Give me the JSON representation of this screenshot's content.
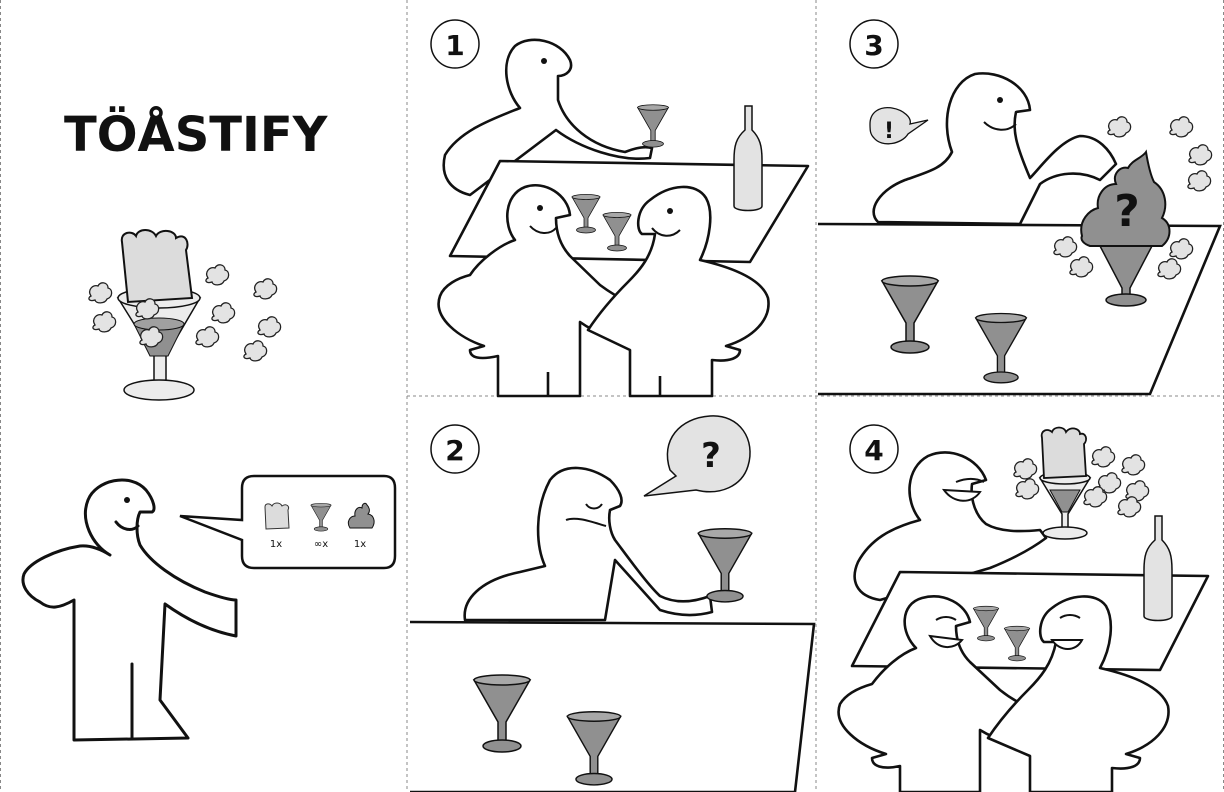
{
  "title": "TÖÅSTIFY",
  "parts": [
    {
      "icon": "bread-slice-icon",
      "qty": "1x"
    },
    {
      "icon": "cocktail-glass-icon",
      "qty": "∞x"
    },
    {
      "icon": "mystery-blob-icon",
      "qty": "1x"
    }
  ],
  "steps": [
    {
      "number": "1",
      "glyph": ""
    },
    {
      "number": "2",
      "glyph": "?"
    },
    {
      "number": "3",
      "glyph": "!",
      "glyph2": "?"
    },
    {
      "number": "4",
      "glyph": ""
    }
  ],
  "colors": {
    "line": "#111111",
    "glass": "#909090",
    "light": "#e3e3e3",
    "divider": "#888888"
  }
}
